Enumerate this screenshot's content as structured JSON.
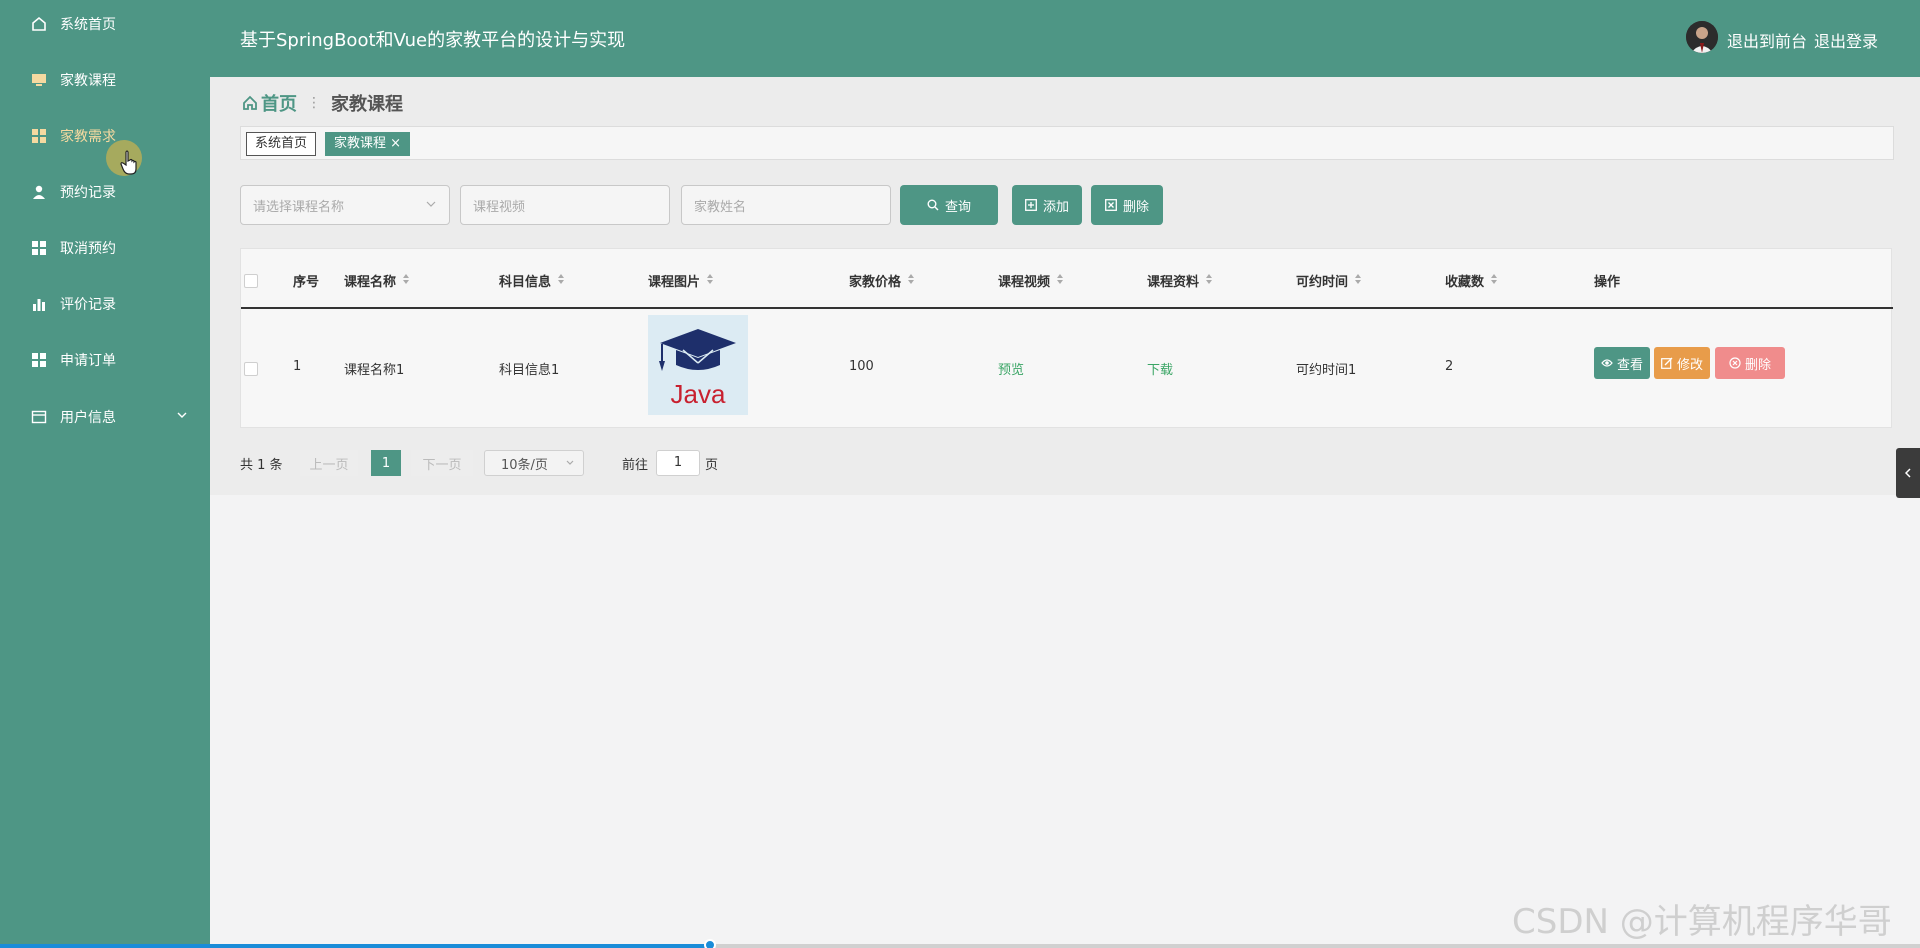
{
  "sidebar": {
    "items": [
      {
        "label": "系统首页",
        "icon": "home-icon"
      },
      {
        "label": "家教课程",
        "icon": "monitor-icon"
      },
      {
        "label": "家教需求",
        "icon": "grid-icon"
      },
      {
        "label": "预约记录",
        "icon": "user-icon"
      },
      {
        "label": "取消预约",
        "icon": "grid-icon"
      },
      {
        "label": "评价记录",
        "icon": "bar-chart-icon"
      },
      {
        "label": "申请订单",
        "icon": "grid-icon"
      },
      {
        "label": "用户信息",
        "icon": "card-icon"
      }
    ]
  },
  "header": {
    "title": "基于SpringBoot和Vue的家教平台的设计与实现",
    "link_front": "退出到前台",
    "link_logout": "退出登录"
  },
  "breadcrumb": {
    "home": "首页",
    "current": "家教课程"
  },
  "tags": [
    {
      "label": "系统首页"
    },
    {
      "label": "家教课程 ×"
    }
  ],
  "search": {
    "course_name_placeholder": "请选择课程名称",
    "course_video_placeholder": "课程视频",
    "teacher_name_placeholder": "家教姓名",
    "query_label": "查询",
    "add_label": "添加",
    "delete_label": "删除"
  },
  "table": {
    "headers": [
      "序号",
      "课程名称",
      "科目信息",
      "课程图片",
      "家教价格",
      "课程视频",
      "课程资料",
      "可约时间",
      "收藏数",
      "操作"
    ],
    "rows": [
      {
        "index": "1",
        "course_name": "课程名称1",
        "subject": "科目信息1",
        "image_text": "Java",
        "price": "100",
        "video": "预览",
        "material": "下载",
        "available_time": "可约时间1",
        "favorites": "2"
      }
    ],
    "actions": {
      "view": "查看",
      "edit": "修改",
      "delete": "删除"
    }
  },
  "pagination": {
    "total": "共 1 条",
    "prev": "上一页",
    "page": "1",
    "next": "下一页",
    "page_size": "10条/页",
    "goto": "前往",
    "goto_value": "1",
    "page_unit": "页"
  },
  "watermark": "CSDN @计算机程序华哥",
  "colors": {
    "primary": "#4e9685",
    "edit": "#e89c4a",
    "delete": "#f08c8c",
    "link": "#3aa565"
  },
  "progress": 0.37
}
